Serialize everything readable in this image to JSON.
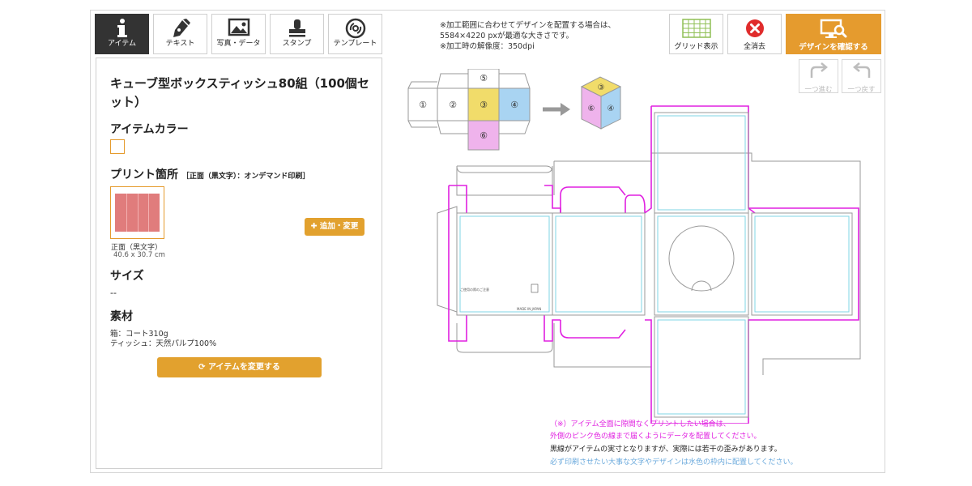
{
  "tools": [
    {
      "label": "アイテム",
      "icon": "info-icon"
    },
    {
      "label": "テキスト",
      "icon": "pen-icon"
    },
    {
      "label": "写真・データ",
      "icon": "image-icon"
    },
    {
      "label": "スタンプ",
      "icon": "stamp-icon"
    },
    {
      "label": "テンプレート",
      "icon": "template-disc-icon"
    }
  ],
  "item_panel": {
    "title": "キューブ型ボックスティッシュ80組（100個セット）",
    "color_heading": "アイテムカラー",
    "print_heading": "プリント箇所",
    "print_note": "［正面（黒文字）：オンデマンド印刷］",
    "print_area_label": "正面（黒文字）",
    "print_area_size": "40.6 x 30.7 cm",
    "add_change_label": "追加・変更",
    "size_heading": "サイズ",
    "size_value": "--",
    "material_heading": "素材",
    "material_box": "箱：コート310g",
    "material_tissue": "ティッシュ：天然パルプ100%",
    "change_item_label": "アイテムを変更する"
  },
  "top_note": {
    "line1": "※加工範囲に合わせてデザインを配置する場合は、",
    "line2": "5584×4220 pxが最適な大きさです。",
    "line3": "※加工時の解像度：350dpi"
  },
  "actions": {
    "grid_label": "グリッド表示",
    "clear_label": "全消去",
    "confirm_label": "デザインを確認する",
    "redo_label": "一つ進む",
    "undo_label": "一つ戻す"
  },
  "diagram": {
    "faces": [
      "①",
      "②",
      "③",
      "④",
      "⑤",
      "⑥"
    ],
    "label_side_text": "ご使用の際のご注意",
    "label_made_in": "MADE IN JAPAN"
  },
  "bottom_notes": {
    "pink1": "（※）アイテム全面に隙間なくプリントしたい場合は、",
    "pink2": "外側のピンク色の線まで届くようにデータを配置してください。",
    "black": "黒線がアイテムの実寸となりますが、実際には若干の歪みがあります。",
    "blue": "必ず印刷させたい大事な文字やデザインは水色の枠内に配置してください。"
  },
  "colors": {
    "accent": "#e59b2e",
    "active_tab": "#333333",
    "bleed_line": "#e020e0",
    "safe_line": "#7fd6e6",
    "face_yellow": "#f1dc6a",
    "face_blue": "#a9d4f2",
    "face_pink": "#efb3ec",
    "clear_red": "#e02c2c",
    "grid_green": "#8fbf55"
  }
}
